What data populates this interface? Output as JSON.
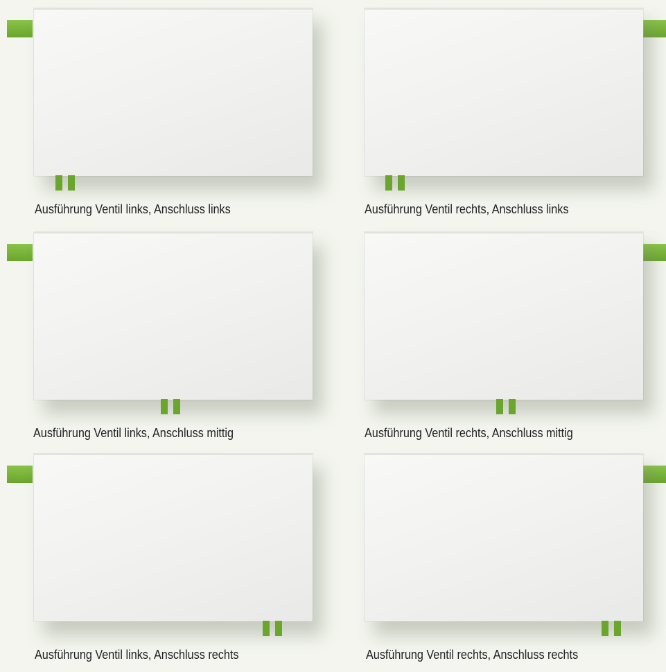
{
  "background_color": "#f3f5ee",
  "accent_color": "#6aa52c",
  "variants": [
    {
      "caption": "Ausführung Ventil links, Anschluss links",
      "valve_side": "left",
      "connection": "left"
    },
    {
      "caption": "Ausführung Ventil rechts, Anschluss links",
      "valve_side": "right",
      "connection": "left"
    },
    {
      "caption": "Ausführung Ventil links, Anschluss mittig",
      "valve_side": "left",
      "connection": "middle"
    },
    {
      "caption": "Ausführung Ventil rechts, Anschluss mittig",
      "valve_side": "right",
      "connection": "middle"
    },
    {
      "caption": "Ausführung Ventil links, Anschluss rechts",
      "valve_side": "left",
      "connection": "right"
    },
    {
      "caption": "Ausführung Ventil rechts, Anschluss rechts",
      "valve_side": "right",
      "connection": "right"
    }
  ]
}
